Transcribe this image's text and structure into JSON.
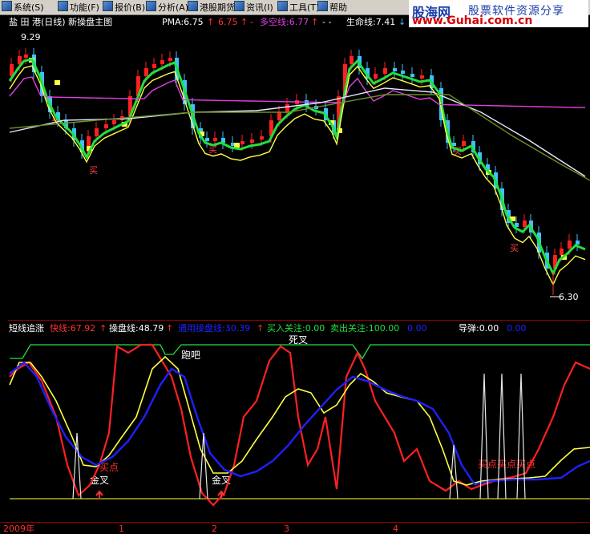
{
  "menu": [
    {
      "label": "系统(S)",
      "icon": "system-icon"
    },
    {
      "label": "功能(F)",
      "icon": "function-icon"
    },
    {
      "label": "报价(B)",
      "icon": "quote-icon"
    },
    {
      "label": "分析(A)",
      "icon": "analysis-icon"
    },
    {
      "label": "港股期货",
      "icon": "hk-futures-icon"
    },
    {
      "label": "资讯(I)",
      "icon": "news-icon"
    },
    {
      "label": "工具(T)",
      "icon": "tools-icon"
    },
    {
      "label": "帮助",
      "icon": "help-icon"
    }
  ],
  "brand": {
    "name": "股海网",
    "slogan": "股票软件资源分享",
    "url": "www.Guhai.com.cn"
  },
  "main_pane": {
    "title": "盐 田 港(日线) 新操盘主图",
    "pma": "PMA:6.75",
    "val2": "6.75",
    "duokong": "多空线:6.77",
    "dashes": "- -",
    "shengming": "生命线:7.41",
    "high_label": "9.29",
    "low_label": "6.30",
    "buy": "买"
  },
  "sub_pane": {
    "name": "短线追涨",
    "kuai": "快线:67.92",
    "caopan": "操盘线:48.79",
    "tongyong": "通用操盘线:30.39",
    "mairu": "买入关注:0.00",
    "maichu": "卖出关注:100.00",
    "zero": "0.00",
    "daodan": "导弹:0.00",
    "zero2": "0.00",
    "paoba": "跑吧",
    "sicha": "死叉",
    "jincha": "金叉",
    "maidian": "买点",
    "maidian_combo": "买点买点买点"
  },
  "axis": {
    "year": "2009年",
    "months": [
      "1",
      "2",
      "3",
      "4"
    ]
  },
  "colors": {
    "up": "#ff2020",
    "down": "#40c0ff",
    "green": "#20e040",
    "yellow": "#ffff40",
    "magenta": "#e040e0",
    "white": "#e8e8ff",
    "olive": "#6b8e23",
    "blue": "#2020ff"
  }
}
